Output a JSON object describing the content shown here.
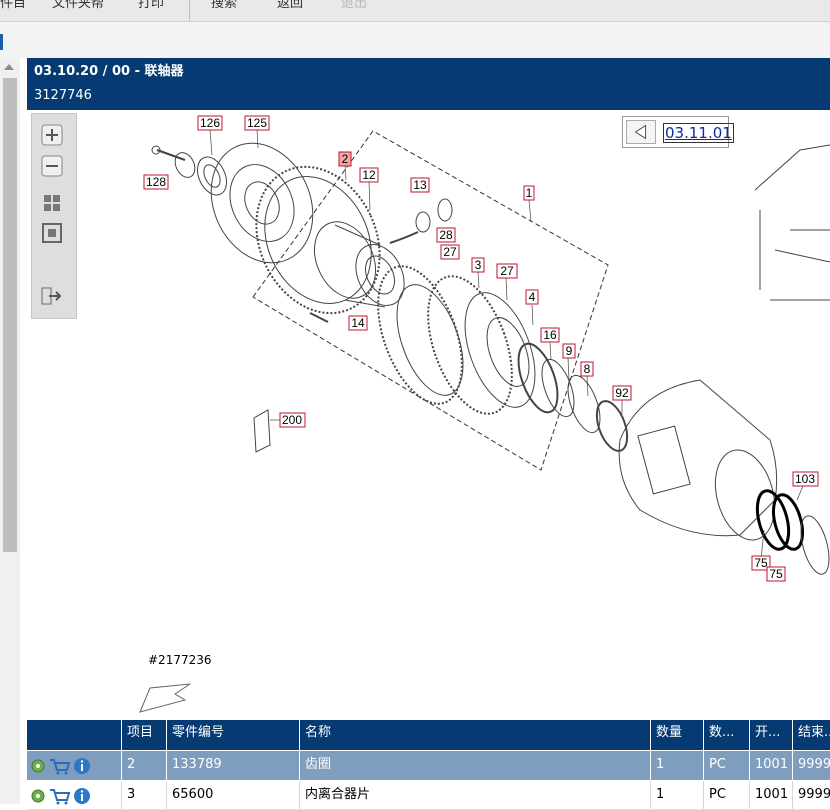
{
  "menu": {
    "items": [
      "件目",
      "文件夹帮",
      "打印",
      "搜索",
      "返回",
      "退出"
    ]
  },
  "header": {
    "title": "03.10.20 / 00 - 联轴器",
    "subtitle": "3127746"
  },
  "page_ref": {
    "label": "03.11.01"
  },
  "drawing": {
    "id_text": "#2177236",
    "callouts": {
      "c126": "126",
      "c125": "125",
      "c128": "128",
      "c2": "2",
      "c12": "12",
      "c13": "13",
      "c28": "28",
      "c1": "1",
      "c27a": "27",
      "c3": "3",
      "c27b": "27",
      "c4": "4",
      "c16": "16",
      "c9": "9",
      "c8": "8",
      "c92": "92",
      "c14": "14",
      "c200": "200",
      "c103": "103",
      "c75a": "75",
      "c75b": "75"
    },
    "highlight_color": "#f4a6a6",
    "callout_border_color": "#c0162b"
  },
  "table": {
    "headers": [
      "",
      "项目",
      "零件编号",
      "名称",
      "数量",
      "数...",
      "开...",
      "结束..."
    ],
    "rows": [
      {
        "item": "2",
        "part_no": "133789",
        "name": "齿圈",
        "qty": "1",
        "unit": "PC",
        "start": "1001",
        "end": "9999"
      },
      {
        "item": "3",
        "part_no": "65600",
        "name": "内离合器片",
        "qty": "1",
        "unit": "PC",
        "start": "1001",
        "end": "9999"
      }
    ]
  },
  "colors": {
    "header_bg": "#053a73",
    "selected_row_bg": "#7f9dbd",
    "callout_red": "#c0162b"
  },
  "icons": {
    "row_actions": [
      "gear-icon",
      "cart-icon",
      "info-icon"
    ],
    "zoom_tools": [
      "zoom-in-icon",
      "zoom-out-icon",
      "fit-all-icon",
      "actual-size-icon",
      "export-icon"
    ]
  }
}
